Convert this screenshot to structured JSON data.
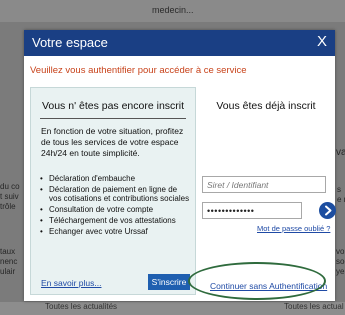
{
  "background": {
    "top_text": "medecin...",
    "fragments": {
      "left_a": "du co\nt suiv\ntrôle",
      "left_b": "taux\nnenc\nulair",
      "right_a": "valit",
      "right_b": "s\ne rer",
      "right_c": "vous\nsoci\nyer."
    },
    "bottom_left": "Toutes les actualités",
    "bottom_right": "Toutes les actual"
  },
  "modal": {
    "title": "Votre espace",
    "close_label": "X",
    "auth_prompt": "Veuillez vous authentifier pour accéder à ce service"
  },
  "left_panel": {
    "title": "Vous n' êtes pas encore inscrit",
    "intro": "En fonction de votre situation, profitez de tous les services de votre espace 24h/24 en toute simplicité.",
    "features": [
      "Déclaration d'embauche",
      "Déclaration de paiement en ligne de vos cotisations et contributions sociales",
      "Consultation de votre compte",
      "Téléchargement de vos attestations",
      "Echanger avec votre Urssaf"
    ],
    "learn_more": "En savoir plus...",
    "signup_label": "S'inscrire"
  },
  "right_panel": {
    "title": "Vous êtes déjà inscrit",
    "login_placeholder": "Siret / Identifiant",
    "password_value": "•••••••••••••",
    "forgot_password": "Mot de passe oublié ?",
    "continue_link": "Continuer sans Authentification"
  },
  "colors": {
    "header": "#1a3f84",
    "prompt": "#c8431b",
    "link": "#1f4aa5",
    "highlight": "#2f6b3d"
  }
}
